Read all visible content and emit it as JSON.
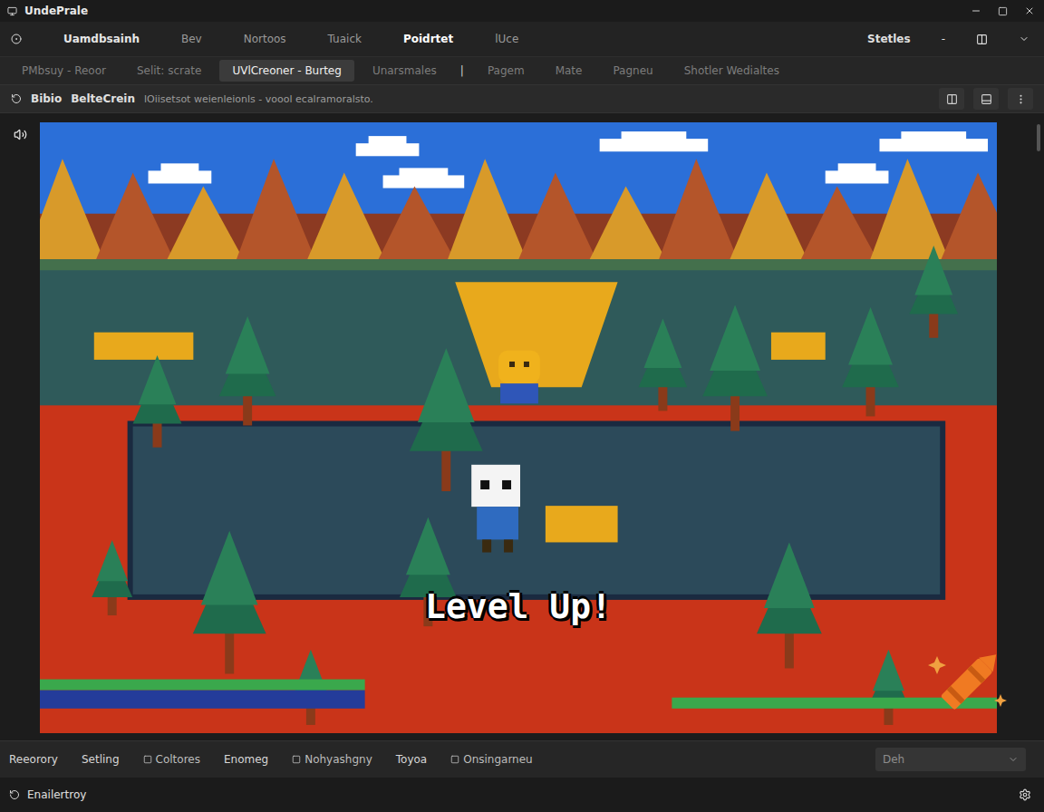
{
  "window": {
    "title": "UndePrale"
  },
  "menu": {
    "items": [
      {
        "label": "Uamdbsainh",
        "selected": false
      },
      {
        "label": "Bev",
        "selected": false
      },
      {
        "label": "Nortoos",
        "selected": false
      },
      {
        "label": "Tuaick",
        "selected": false
      },
      {
        "label": "Poidrtet",
        "selected": true
      },
      {
        "label": "lUce",
        "selected": false
      }
    ],
    "right": [
      "Stetles",
      "-"
    ]
  },
  "tabs": [
    {
      "label": "PMbsuy - Reoor",
      "selected": false,
      "kind": "tab"
    },
    {
      "label": "Selit: scrate",
      "selected": false,
      "kind": "tab"
    },
    {
      "label": "UVlCreoner - Burteg",
      "selected": true,
      "kind": "tab"
    },
    {
      "label": "Unarsmales",
      "selected": false,
      "kind": "tab"
    },
    {
      "label": "|",
      "selected": false,
      "kind": "separator"
    },
    {
      "label": "Pagem",
      "selected": false,
      "kind": "tab"
    },
    {
      "label": "Mate",
      "selected": false,
      "kind": "tab"
    },
    {
      "label": "Pagneu",
      "selected": false,
      "kind": "tab"
    },
    {
      "label": "Shotler Wedialtes",
      "selected": false,
      "kind": "tab"
    }
  ],
  "address": {
    "items": [
      "Bibio",
      "BelteCrein"
    ],
    "path": "lOiisetsot weienleionls - voool ecalramoralsto."
  },
  "game": {
    "overlay_text": "Level Up!"
  },
  "bottom_bar": {
    "items": [
      {
        "label": "Reeorory",
        "kind": "plain"
      },
      {
        "label": "Setling",
        "kind": "plain"
      },
      {
        "label": "Coltores",
        "kind": "icon"
      },
      {
        "label": "Enomeg",
        "kind": "plain"
      },
      {
        "label": "Nohyashgny",
        "kind": "icon"
      },
      {
        "label": "Toyoa",
        "kind": "plain"
      },
      {
        "label": "Onsingarneu",
        "kind": "icon"
      }
    ],
    "dropdown": {
      "value": "Deh"
    }
  },
  "status_bar": {
    "text": "Enailertroy"
  }
}
